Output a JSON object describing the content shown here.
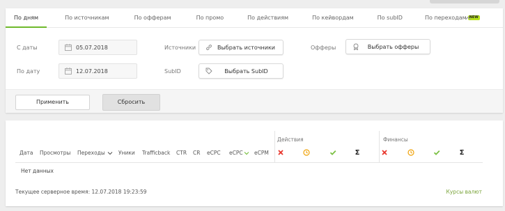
{
  "tabs": [
    {
      "label": "По дням",
      "active": true
    },
    {
      "label": "По источникам"
    },
    {
      "label": "По офферам"
    },
    {
      "label": "По промо"
    },
    {
      "label": "По действиям"
    },
    {
      "label": "По кейвордам"
    },
    {
      "label": "По subID"
    },
    {
      "label": "По переходам",
      "badge": "NEW"
    }
  ],
  "filters": {
    "date_from_label": "С даты",
    "date_from_value": "05.07.2018",
    "date_to_label": "По дату",
    "date_to_value": "12.07.2018",
    "sources_label": "Источники",
    "sources_button": "Выбрать источники",
    "subid_label": "SubID",
    "subid_button": "Выбрать SubID",
    "offers_label": "Офферы",
    "offers_button": "Выбрать офферы"
  },
  "actions": {
    "apply": "Применить",
    "reset": "Сбросить"
  },
  "table": {
    "columns": [
      "Дата",
      "Просмотры",
      "Переходы",
      "Уники",
      "Trafficback",
      "CTR",
      "CR",
      "eCPC",
      "eCPC",
      "eCPM"
    ],
    "group_actions": "Действия",
    "group_finance": "Финансы",
    "sigma": "Σ",
    "empty": "Нет данных"
  },
  "footer": {
    "server_time": "Текущее серверное время: 12.07.2018 19:23:59",
    "rates_link": "Курсы валют"
  },
  "colors": {
    "accent": "#6eb92b",
    "red": "#e8342b",
    "orange": "#f0a30a",
    "green": "#7bc043",
    "link": "#7aa43a"
  }
}
